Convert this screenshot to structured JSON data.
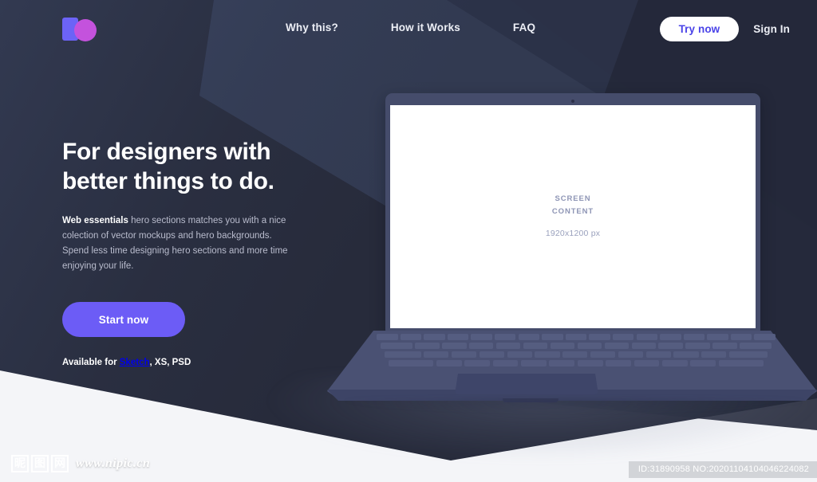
{
  "header": {
    "logo_name": "brand-logo",
    "nav": [
      {
        "label": "Why this?"
      },
      {
        "label": "How it Works"
      },
      {
        "label": "FAQ"
      }
    ],
    "try_now_label": "Try now",
    "sign_in_label": "Sign In"
  },
  "hero": {
    "title_line1": "For designers with",
    "title_line2": "better things to do.",
    "paragraph_bold": "Web essentials",
    "paragraph_rest": " hero sections matches you with a nice colection of vector mockups and hero backgrounds. Spend less time designing hero sections and more time enjoying your life.",
    "cta_label": "Start now",
    "available_prefix": "Available for ",
    "available_link": "Sketch",
    "available_rest": ", XS, PSD"
  },
  "mockup": {
    "screen_line1": "SCREEN",
    "screen_line2": "CONTENT",
    "screen_size": "1920x1200 px"
  },
  "watermark": {
    "char1": "昵",
    "char2": "图",
    "char3": "网",
    "url": "www.nipic.cn",
    "id_text": "ID:31890958 NO:20201104104046224082"
  },
  "colors": {
    "bg_dark": "#272b3b",
    "bg_band": "#333a52",
    "accent_purple": "#6c5cf6",
    "logo_square": "#6c63f7",
    "logo_circle": "#c452dd",
    "try_now_text": "#4a43e8",
    "laptop_body": "#454c6b",
    "laptop_key": "#565e82",
    "screen_text": "#8e95b5"
  }
}
